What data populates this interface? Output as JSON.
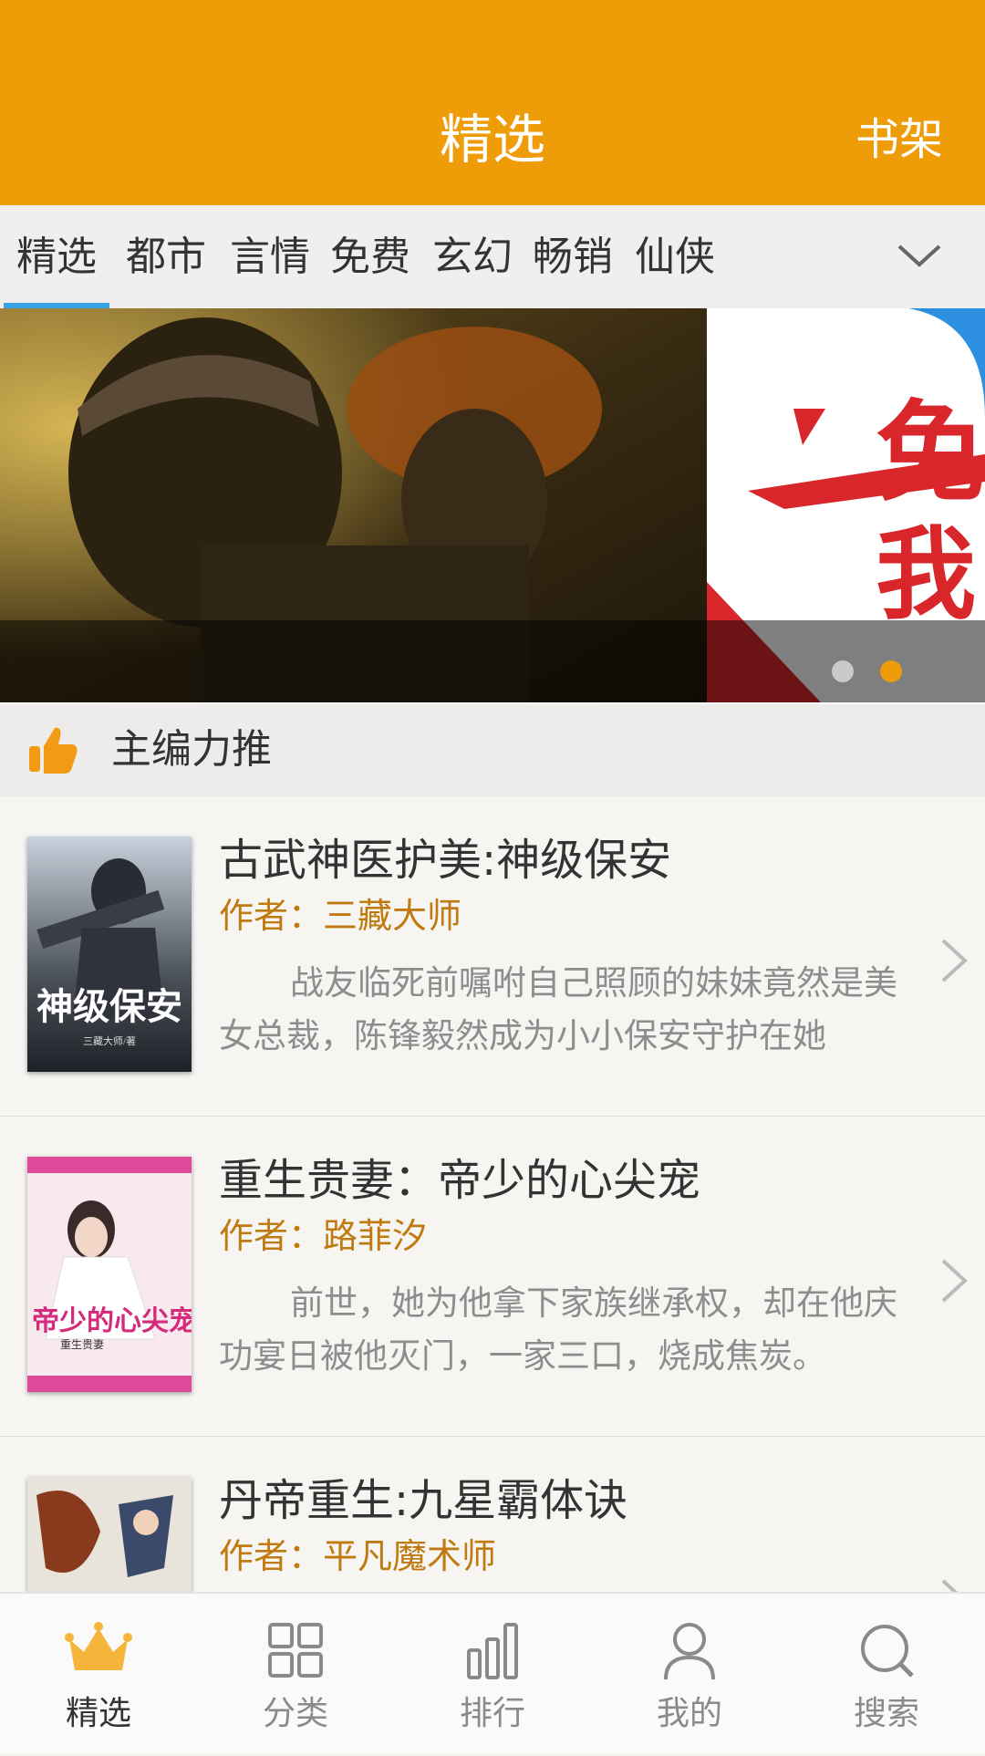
{
  "header": {
    "title": "精选",
    "right_action": "书架"
  },
  "tabs": [
    {
      "label": "精选",
      "active": true
    },
    {
      "label": "都市"
    },
    {
      "label": "言情"
    },
    {
      "label": "免费"
    },
    {
      "label": "玄幻"
    },
    {
      "label": "畅销"
    },
    {
      "label": "仙侠"
    }
  ],
  "banner": {
    "slide_count": 2,
    "active_index": 1,
    "right_slide_text": "免 我"
  },
  "section": {
    "title": "主编力推",
    "icon": "thumbs-up-icon"
  },
  "books": [
    {
      "title": "古武神医护美:神级保安",
      "author": "作者：三藏大师",
      "desc": "战友临死前嘱咐自己照顾的妹妹竟然是美女总裁，陈锋毅然成为小小保安守护在她",
      "cover_text": "神级保安",
      "cover_author": "三藏大师/著"
    },
    {
      "title": "重生贵妻：帝少的心尖宠",
      "author": "作者：路菲汐",
      "desc": "前世，她为他拿下家族继承权，却在他庆功宴日被他灭门，一家三口，烧成焦炭。",
      "cover_text": "帝少的心尖宠",
      "cover_author": "重生贵妻"
    },
    {
      "title": "丹帝重生:九星霸体诀",
      "author": "作者：平凡魔术师",
      "desc": "",
      "cover_text": "",
      "cover_author": ""
    }
  ],
  "bottom_nav": [
    {
      "label": "精选",
      "icon": "crown-icon",
      "active": true
    },
    {
      "label": "分类",
      "icon": "grid-icon"
    },
    {
      "label": "排行",
      "icon": "bar-chart-icon"
    },
    {
      "label": "我的",
      "icon": "user-icon"
    },
    {
      "label": "搜索",
      "icon": "search-icon"
    }
  ],
  "colors": {
    "primary": "#ee9c08",
    "tab_indicator": "#37a3e6",
    "author": "#c07a10"
  }
}
